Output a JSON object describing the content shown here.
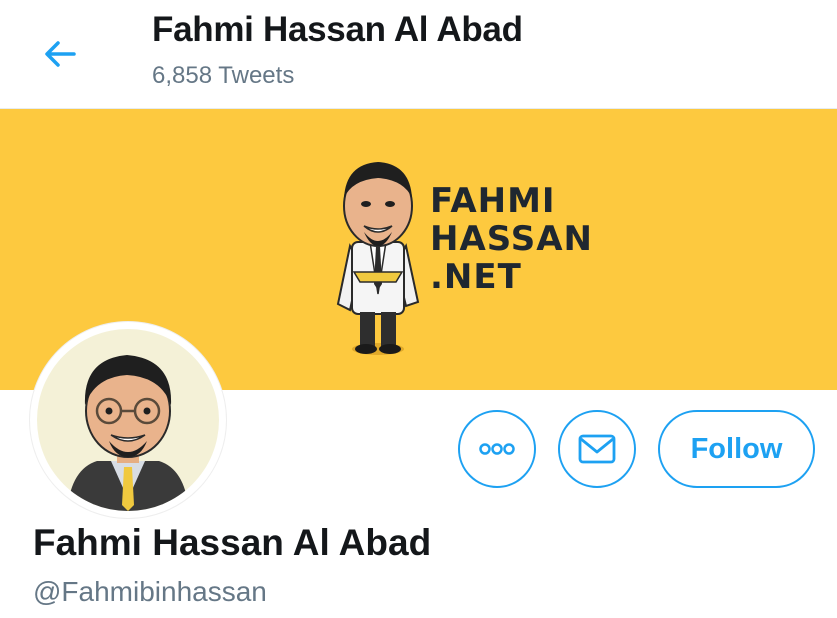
{
  "header": {
    "title": "Fahmi Hassan Al Abad",
    "tweet_count": "6,858 Tweets",
    "back_icon": "arrow-left-icon"
  },
  "banner": {
    "background": "#fdc93f",
    "logo_lines": [
      "FAHMI",
      "HASSAN",
      ".NET"
    ]
  },
  "profile": {
    "name": "Fahmi Hassan Al Abad",
    "handle": "@Fahmibinhassan"
  },
  "actions": {
    "more_icon": "more-options-icon",
    "message_icon": "envelope-icon",
    "follow_label": "Follow"
  },
  "colors": {
    "accent": "#1da1f2",
    "text_primary": "#14171a",
    "text_secondary": "#657786"
  }
}
